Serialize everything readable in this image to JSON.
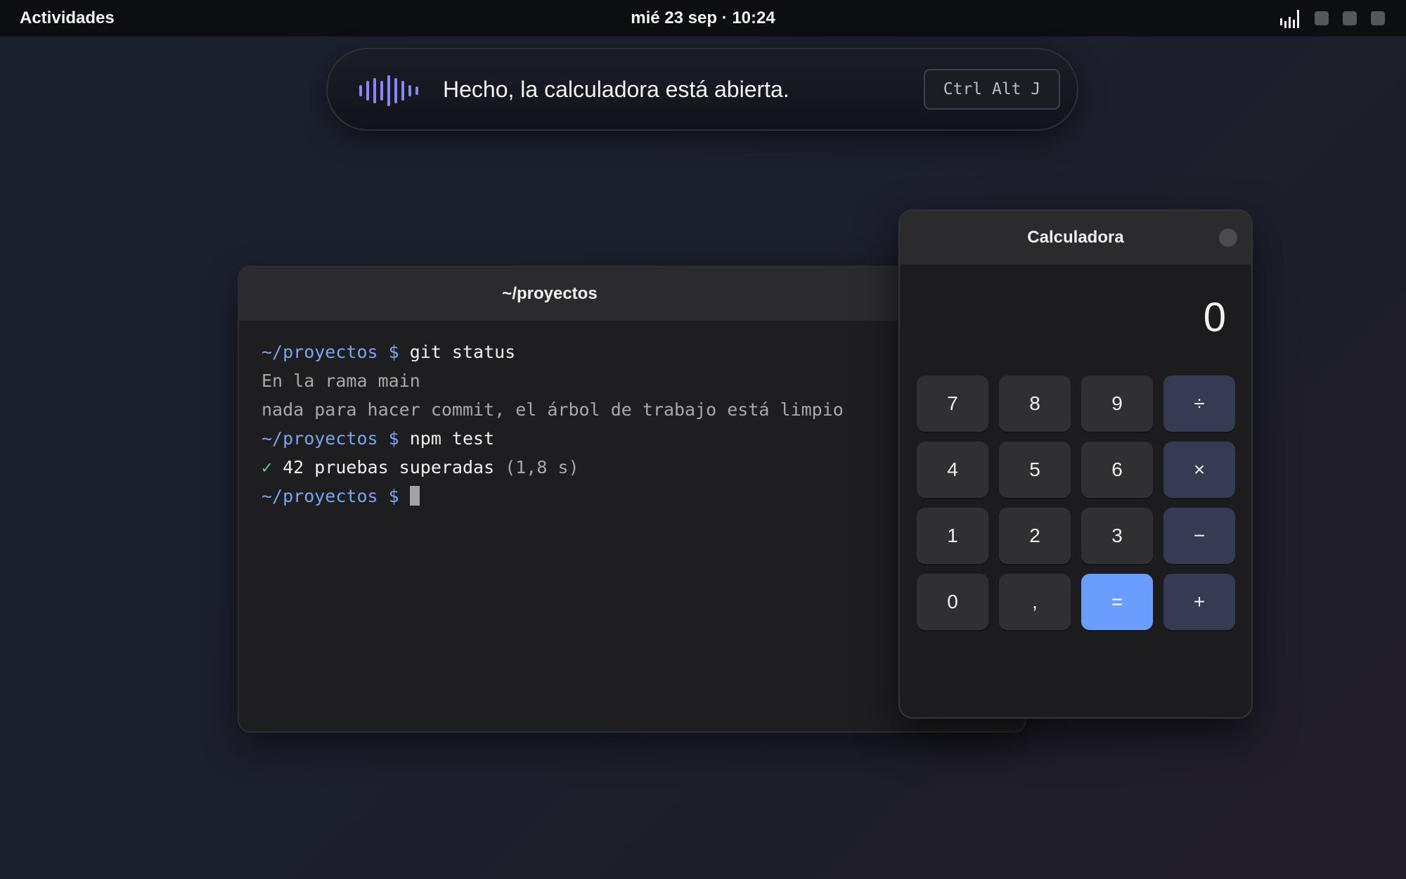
{
  "topbar": {
    "activities": "Actividades",
    "clock": "mié 23 sep · 10:24",
    "tray_icons": [
      "signal-icon",
      "tray-square-icon",
      "tray-square-icon",
      "tray-square-icon"
    ]
  },
  "assistant": {
    "message": "Hecho, la calculadora está abierta.",
    "shortcut": "Ctrl Alt J",
    "icon": "voice-waveform-icon",
    "accent_from": "#6f8cff",
    "accent_to": "#a77cf2"
  },
  "terminal": {
    "title": "~/proyectos",
    "lines": [
      {
        "prompt": "~/proyectos $ ",
        "command": "git status"
      },
      {
        "output": "En la rama main"
      },
      {
        "output": "nada para hacer commit, el árbol de trabajo está limpio"
      },
      {
        "prompt": "~/proyectos $ ",
        "command": "npm test"
      },
      {
        "check": "✓",
        "text": " 42 pruebas superadas",
        "meta": " (1,8 s)"
      },
      {
        "prompt": "~/proyectos $ "
      }
    ],
    "colors": {
      "prompt": "#78a5f0",
      "ok": "#5fcf80"
    }
  },
  "calculator": {
    "title": "Calculadora",
    "display": "0",
    "keys": [
      {
        "label": "7",
        "kind": "digit",
        "name": "key-7"
      },
      {
        "label": "8",
        "kind": "digit",
        "name": "key-8"
      },
      {
        "label": "9",
        "kind": "digit",
        "name": "key-9"
      },
      {
        "label": "÷",
        "kind": "op",
        "name": "key-divide"
      },
      {
        "label": "4",
        "kind": "digit",
        "name": "key-4"
      },
      {
        "label": "5",
        "kind": "digit",
        "name": "key-5"
      },
      {
        "label": "6",
        "kind": "digit",
        "name": "key-6"
      },
      {
        "label": "×",
        "kind": "op",
        "name": "key-multiply"
      },
      {
        "label": "1",
        "kind": "digit",
        "name": "key-1"
      },
      {
        "label": "2",
        "kind": "digit",
        "name": "key-2"
      },
      {
        "label": "3",
        "kind": "digit",
        "name": "key-3"
      },
      {
        "label": "−",
        "kind": "op",
        "name": "key-minus"
      },
      {
        "label": "0",
        "kind": "digit",
        "name": "key-0"
      },
      {
        "label": ",",
        "kind": "digit",
        "name": "key-decimal"
      },
      {
        "label": "=",
        "kind": "eq",
        "name": "key-equals"
      },
      {
        "label": "+",
        "kind": "op",
        "name": "key-plus"
      }
    ],
    "colors": {
      "operator": "#343b53",
      "equals": "#6b9cff"
    }
  }
}
